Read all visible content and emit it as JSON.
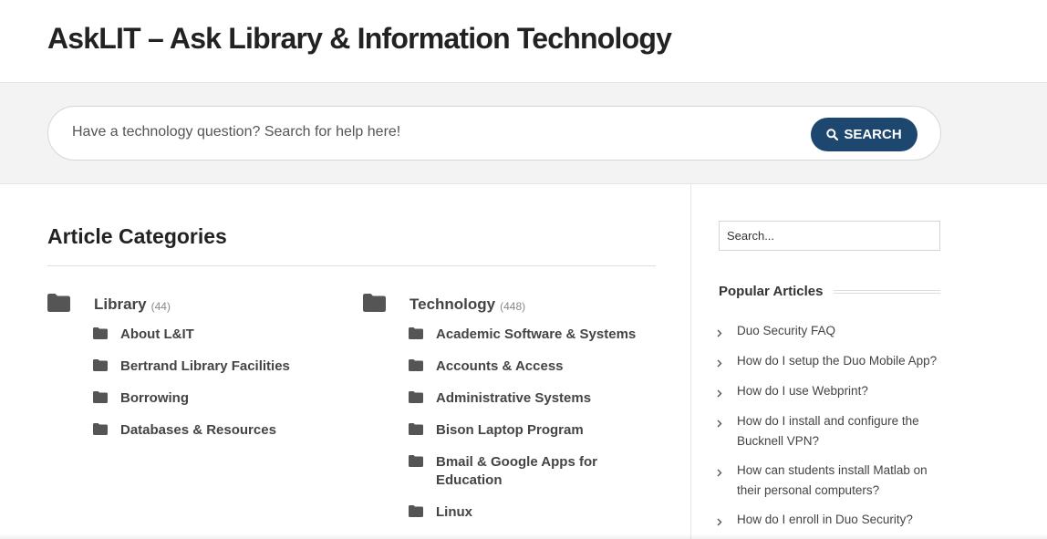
{
  "header": {
    "title": "AskLIT – Ask Library & Information Technology"
  },
  "hero_search": {
    "placeholder": "Have a technology question? Search for help here!",
    "button_label": "SEARCH"
  },
  "main": {
    "heading": "Article Categories",
    "categories": [
      {
        "name": "Library",
        "count": "(44)",
        "subcategories": [
          "About L&IT",
          "Bertrand Library Facilities",
          "Borrowing",
          "Databases & Resources"
        ]
      },
      {
        "name": "Technology",
        "count": "(448)",
        "subcategories": [
          "Academic Software & Systems",
          "Accounts & Access",
          "Administrative Systems",
          "Bison Laptop Program",
          "Bmail & Google Apps for Education",
          "Linux"
        ]
      }
    ]
  },
  "sidebar": {
    "search_placeholder": "Search...",
    "popular_heading": "Popular Articles",
    "popular_articles": [
      "Duo Security FAQ",
      "How do I setup the Duo Mobile App?",
      "How do I use Webprint?",
      "How do I install and configure the Bucknell VPN?",
      "How can students install Matlab on their personal computers?",
      "How do I enroll in Duo Security?"
    ]
  },
  "colors": {
    "accent": "#1e4770",
    "folder_icon": "#555555",
    "band_background": "#f3f3f3"
  },
  "icons": {
    "search_button": "search-icon",
    "category": "folder-icon",
    "popular_bullet": "chevron-right-icon"
  }
}
